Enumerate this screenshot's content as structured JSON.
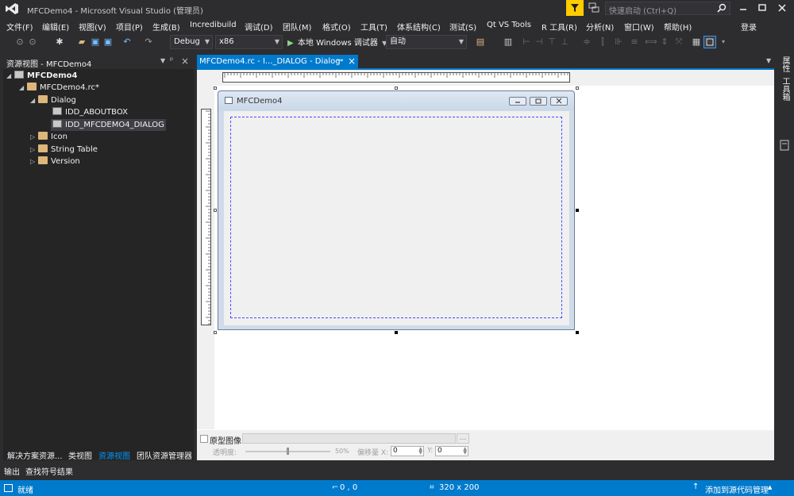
{
  "window": {
    "title": "MFCDemo4 - Microsoft Visual Studio (管理员)",
    "quick_launch_placeholder": "快速启动 (Ctrl+Q)",
    "sign_in": "登录"
  },
  "menu": [
    "文件(F)",
    "编辑(E)",
    "视图(V)",
    "项目(P)",
    "生成(B)",
    "Incredibuild",
    "调试(D)",
    "团队(M)",
    "格式(O)",
    "工具(T)",
    "体系结构(C)",
    "测试(S)",
    "Qt VS Tools",
    "R 工具(R)",
    "分析(N)",
    "窗口(W)",
    "帮助(H)"
  ],
  "toolbar": {
    "config": "Debug",
    "platform": "x86",
    "debugger": "本地 Windows 调试器",
    "debug_mode": "自动"
  },
  "left_panel": {
    "title": "资源视图 - MFCDemo4",
    "tree": [
      {
        "label": "MFCDemo4",
        "bold": true
      },
      {
        "label": "MFCDemo4.rc*"
      },
      {
        "label": "Dialog"
      },
      {
        "label": "IDD_ABOUTBOX"
      },
      {
        "label": "IDD_MFCDEMO4_DIALOG",
        "selected": true
      },
      {
        "label": "Icon"
      },
      {
        "label": "String Table"
      },
      {
        "label": "Version"
      }
    ],
    "bottom_tabs": [
      "解决方案资源...",
      "类视图",
      "资源视图",
      "团队资源管理器"
    ]
  },
  "doc_tab": {
    "title": "MFCDemo4.rc - I..._DIALOG - Dialog",
    "pin_icon": "pin-icon",
    "close_icon": "close-icon"
  },
  "dialog": {
    "caption": "MFCDemo4"
  },
  "right_strip": [
    "属性",
    "工具箱"
  ],
  "prototype_bar": {
    "checkbox_label": "原型图像:",
    "browse": "...",
    "transparency_label": "透明度:",
    "transparency_value": "50%",
    "transparency_fraction": 0.5,
    "offset_label": "偏移量 X:",
    "offset_x": "0",
    "y_label": "Y:",
    "offset_y": "0"
  },
  "output_tabs": [
    "输出",
    "查找符号结果"
  ],
  "status": {
    "ready": "就绪",
    "position": "0 , 0",
    "size": "320 x 200",
    "source_control": "添加到源代码管理"
  },
  "colors": {
    "accent": "#007acc",
    "bg_dark": "#2d2d30",
    "panel": "#252526",
    "notify": "#ffcc00"
  }
}
